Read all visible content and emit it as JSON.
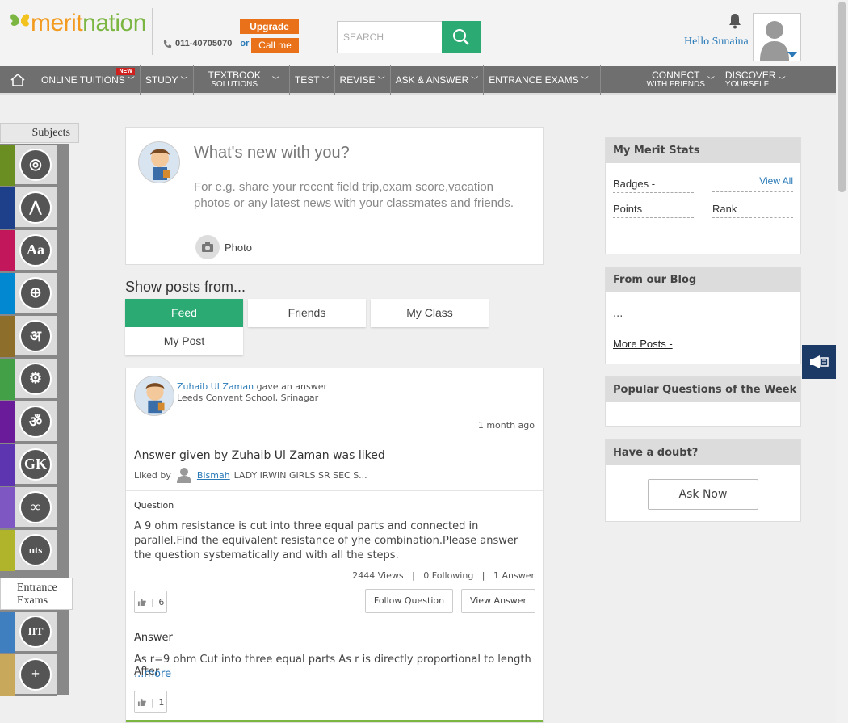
{
  "header": {
    "logo_merit": "merit",
    "logo_nation": "nation",
    "upgrade_label": "Upgrade",
    "phone": "011-40705070",
    "or_text": "or",
    "callme_label": "Call me",
    "search_placeholder": "SEARCH",
    "greeting": "Hello Sunaina"
  },
  "nav": {
    "online_tuitions": "ONLINE TUITIONS",
    "new_badge": "NEW",
    "study": "STUDY",
    "textbook_line1": "TEXTBOOK",
    "textbook_line2": "SOLUTIONS",
    "test": "TEST",
    "revise": "REVISE",
    "ask_answer": "ASK & ANSWER",
    "entrance_exams": "ENTRANCE EXAMS",
    "connect_line1": "CONNECT",
    "connect_line2": "WITH FRIENDS",
    "discover_line1": "DISCOVER",
    "discover_line2": "YOURSELF"
  },
  "sidebar": {
    "subjects_label": "Subjects",
    "entrance_label": "Entrance Exams",
    "subjects": [
      {
        "icon": "biology-icon",
        "color": "#6b8e23",
        "glyph": "◎"
      },
      {
        "icon": "maths-compass-icon",
        "color": "#1e3f8a",
        "glyph": "⋀"
      },
      {
        "icon": "english-icon",
        "color": "#c2185b",
        "glyph": "Aa"
      },
      {
        "icon": "globe-icon",
        "color": "#0288d1",
        "glyph": "⊕"
      },
      {
        "icon": "hindi-icon",
        "color": "#8d6e2a",
        "glyph": "अ"
      },
      {
        "icon": "gears-icon",
        "color": "#43a047",
        "glyph": "⚙"
      },
      {
        "icon": "sanskrit-icon",
        "color": "#6a1b9a",
        "glyph": "ॐ"
      },
      {
        "icon": "gk-icon",
        "color": "#5e35b1",
        "glyph": "GK"
      },
      {
        "icon": "olympiad-icon",
        "color": "#7e57c2",
        "glyph": "∞"
      },
      {
        "icon": "ntse-icon",
        "color": "#afb42b",
        "glyph": "nts"
      }
    ],
    "entrance": [
      {
        "icon": "iit-icon",
        "color": "#3f7fbf",
        "glyph": "IIT"
      },
      {
        "icon": "plus-icon",
        "color": "#c8a85a",
        "glyph": "+"
      }
    ]
  },
  "composer": {
    "title": "What's new with you?",
    "hint": "For e.g. share your recent field trip,exam score,vacation photos or any latest news with your classmates and friends.",
    "photo_label": "Photo"
  },
  "filters": {
    "heading": "Show posts from...",
    "tabs": [
      "Feed",
      "Friends",
      "My Class",
      "My Post"
    ]
  },
  "feed": {
    "author_name": "Zuhaib Ul Zaman",
    "action": "gave an answer",
    "school": "Leeds Convent School, Srinagar",
    "time": "1 month ago",
    "headline": "Answer given by Zuhaib Ul Zaman was liked",
    "liked_by_prefix": "Liked by",
    "liker_name": "Bismah",
    "liker_school": "LADY IRWIN GIRLS SR SEC S...",
    "question_label": "Question",
    "question_text": "A 9 ohm resistance is cut into three equal parts and connected in parallel.Find the equivalent resistance of yhe combination.Please answer the question systematically and with all the steps.",
    "stats": "2444 Views   |   0 Following   |   1 Answer",
    "question_likes": "6",
    "follow_label": "Follow Question",
    "view_answer_label": "View Answer",
    "answer_label": "Answer",
    "answer_text": "As r=9 ohm Cut into three equal parts As r is directly proportional to length After",
    "more_label": "...more",
    "answer_likes": "1"
  },
  "right": {
    "merit_title": "My Merit Stats",
    "badges_label": "Badges -",
    "view_all": "View All",
    "points_label": "Points",
    "rank_label": "Rank",
    "blog_title": "From our Blog",
    "blog_ellipsis": "...",
    "more_posts": "More Posts -",
    "popular_title": "Popular Questions of the Week",
    "doubt_title": "Have a doubt?",
    "ask_now": "Ask Now"
  }
}
